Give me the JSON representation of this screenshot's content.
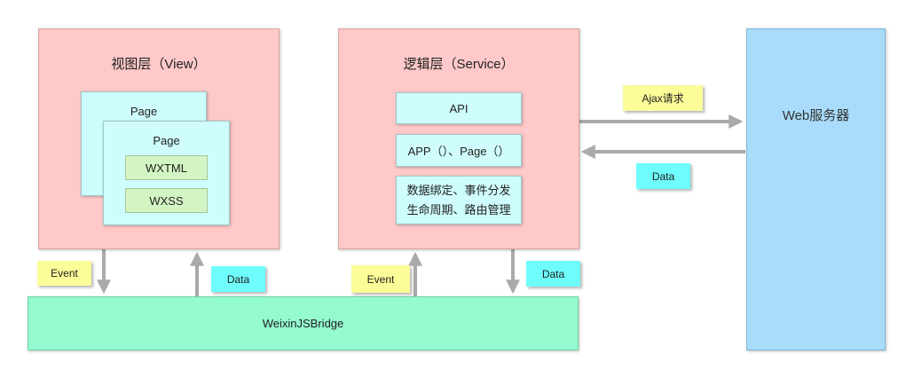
{
  "view_layer": {
    "title": "视图层（View）",
    "page_back_label": "Page",
    "page_front_label": "Page",
    "wxtml_label": "WXTML",
    "wxss_label": "WXSS"
  },
  "service_layer": {
    "title": "逻辑层（Service）",
    "api_label": "API",
    "app_page_label": "APP（）、Page（）",
    "features_line1": "数据绑定、事件分发",
    "features_line2": "生命周期、路由管理"
  },
  "web_server": {
    "label": "Web服务器"
  },
  "bridge": {
    "label": "WeixinJSBridge"
  },
  "notes": {
    "ajax": "Ajax请求",
    "data_right": "Data",
    "event_left": "Event",
    "data_left": "Data",
    "event_mid": "Event",
    "data_mid": "Data"
  },
  "colors": {
    "layer_fill": "#ffc9c9",
    "page_fill": "#cffcfc",
    "tag_fill": "#d3f5c4",
    "server_fill": "#a8dcfa",
    "bridge_fill": "#94fbd0",
    "note_yellow": "#fcfc99",
    "note_aqua": "#6ffcfc",
    "arrow": "#aaaaaa"
  }
}
